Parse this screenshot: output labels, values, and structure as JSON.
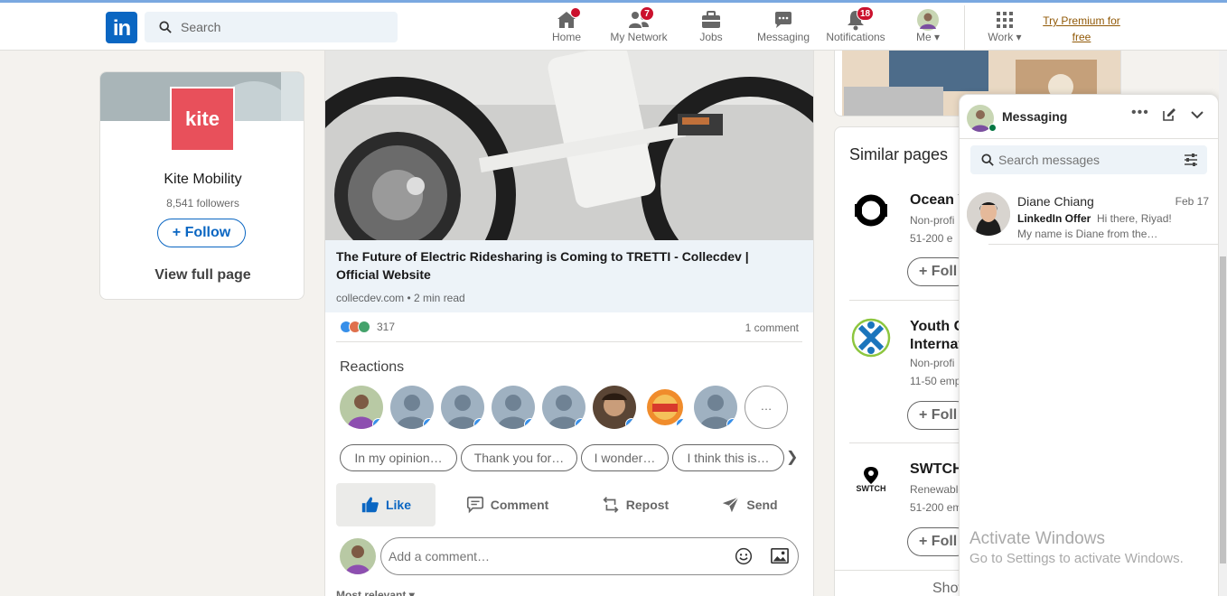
{
  "header": {
    "logo_text": "in",
    "search_placeholder": "Search",
    "nav": [
      {
        "label": "Home",
        "icon": "home-icon",
        "badge": ""
      },
      {
        "label": "My Network",
        "icon": "network-icon",
        "badge": "7"
      },
      {
        "label": "Jobs",
        "icon": "briefcase-icon",
        "badge": ""
      },
      {
        "label": "Messaging",
        "icon": "chat-icon",
        "badge": ""
      },
      {
        "label": "Notifications",
        "icon": "bell-icon",
        "badge": "18"
      },
      {
        "label": "Me",
        "icon": "avatar",
        "badge": ""
      },
      {
        "label": "Work",
        "icon": "grid-icon",
        "badge": ""
      }
    ],
    "premium_line1": "Try Premium for",
    "premium_line2": "free"
  },
  "company_card": {
    "logo_text": "kite",
    "name": "Kite Mobility",
    "followers": "8,541 followers",
    "follow_label": "Follow",
    "view_full_page": "View full page"
  },
  "post": {
    "link_title": "The Future of Electric Ridesharing is Coming to TRETTI - Collecdev | Official Website",
    "link_meta": "collecdev.com • 2 min read",
    "reactions_count": "317",
    "comments_count": "1 comment",
    "reactions_heading": "Reactions",
    "more_reactors": "…",
    "chips": [
      "In my opinion…",
      "Thank you for…",
      "I wonder…",
      "I think this is…"
    ],
    "actions": {
      "like": "Like",
      "comment": "Comment",
      "repost": "Repost",
      "send": "Send"
    },
    "comment_placeholder": "Add a comment…",
    "sort_label": "Most relevant"
  },
  "similar_pages": {
    "heading": "Similar pages",
    "items": [
      {
        "name": "Ocean V",
        "line1": "Non-profi",
        "line2": "51-200 e",
        "follow": "Foll"
      },
      {
        "name": "Youth C",
        "name2": "Internat",
        "line1": "Non-profi",
        "line2": "11-50 emp",
        "follow": "Foll"
      },
      {
        "name": "SWTCH",
        "line1": "Renewable",
        "line2": "51-200 em",
        "follow": "Foll",
        "logo_text": "SWTCH"
      }
    ],
    "show_more": "Show"
  },
  "messaging": {
    "title": "Messaging",
    "search_placeholder": "Search messages",
    "conversations": [
      {
        "name": "Diane Chiang",
        "date": "Feb 17",
        "tag": "LinkedIn Offer",
        "preview1": "Hi there, Riyad!",
        "preview2": "My name is Diane from the…"
      }
    ]
  },
  "watermark": {
    "line1": "Activate Windows",
    "line2": "Go to Settings to activate Windows."
  },
  "colors": {
    "brand": "#0a66c2",
    "kite": "#e8505b",
    "badge": "#cb112d",
    "premium": "#915907"
  }
}
